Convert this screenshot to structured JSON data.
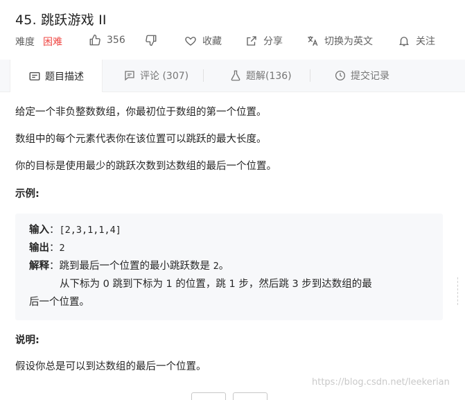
{
  "problem": {
    "title": "45. 跳跃游戏 II",
    "difficulty_label": "难度",
    "difficulty_value": "困难",
    "like_count": "356",
    "favorite_label": "收藏",
    "share_label": "分享",
    "language_label": "切换为英文",
    "follow_label": "关注"
  },
  "tabs": [
    {
      "label": "题目描述",
      "icon": "description-icon"
    },
    {
      "label": "评论 (307)",
      "icon": "comment-icon"
    },
    {
      "label": "题解(136)",
      "icon": "flask-icon"
    },
    {
      "label": "提交记录",
      "icon": "clock-icon"
    }
  ],
  "description": {
    "p1": "给定一个非负整数数组，你最初位于数组的第一个位置。",
    "p2": "数组中的每个元素代表你在该位置可以跳跃的最大长度。",
    "p3": "你的目标是使用最少的跳跃次数到达数组的最后一个位置。",
    "example_heading": "示例:",
    "example": {
      "input_key": "输入",
      "input_val": "[2,3,1,1,4]",
      "output_key": "输出",
      "output_val": "2",
      "explain_key": "解释",
      "explain_text_a": "跳到最后一个位置的最小跳跃数是 ",
      "explain_num": "2",
      "explain_text_b": "。",
      "explain_line2": "从下标为 0 跳到下标为 1 的位置，跳 1 步，然后跳 3 步到达数组的最",
      "explain_line3": "后一个位置。"
    },
    "note_heading": "说明:",
    "note": "假设你总是可以到达数组的最后一个位置。"
  },
  "watermark": "https://blog.csdn.net/leekerian",
  "colors": {
    "hard": "#ef4743",
    "tab_bg": "#f7f8fa",
    "example_bg": "#f7f8fa"
  }
}
